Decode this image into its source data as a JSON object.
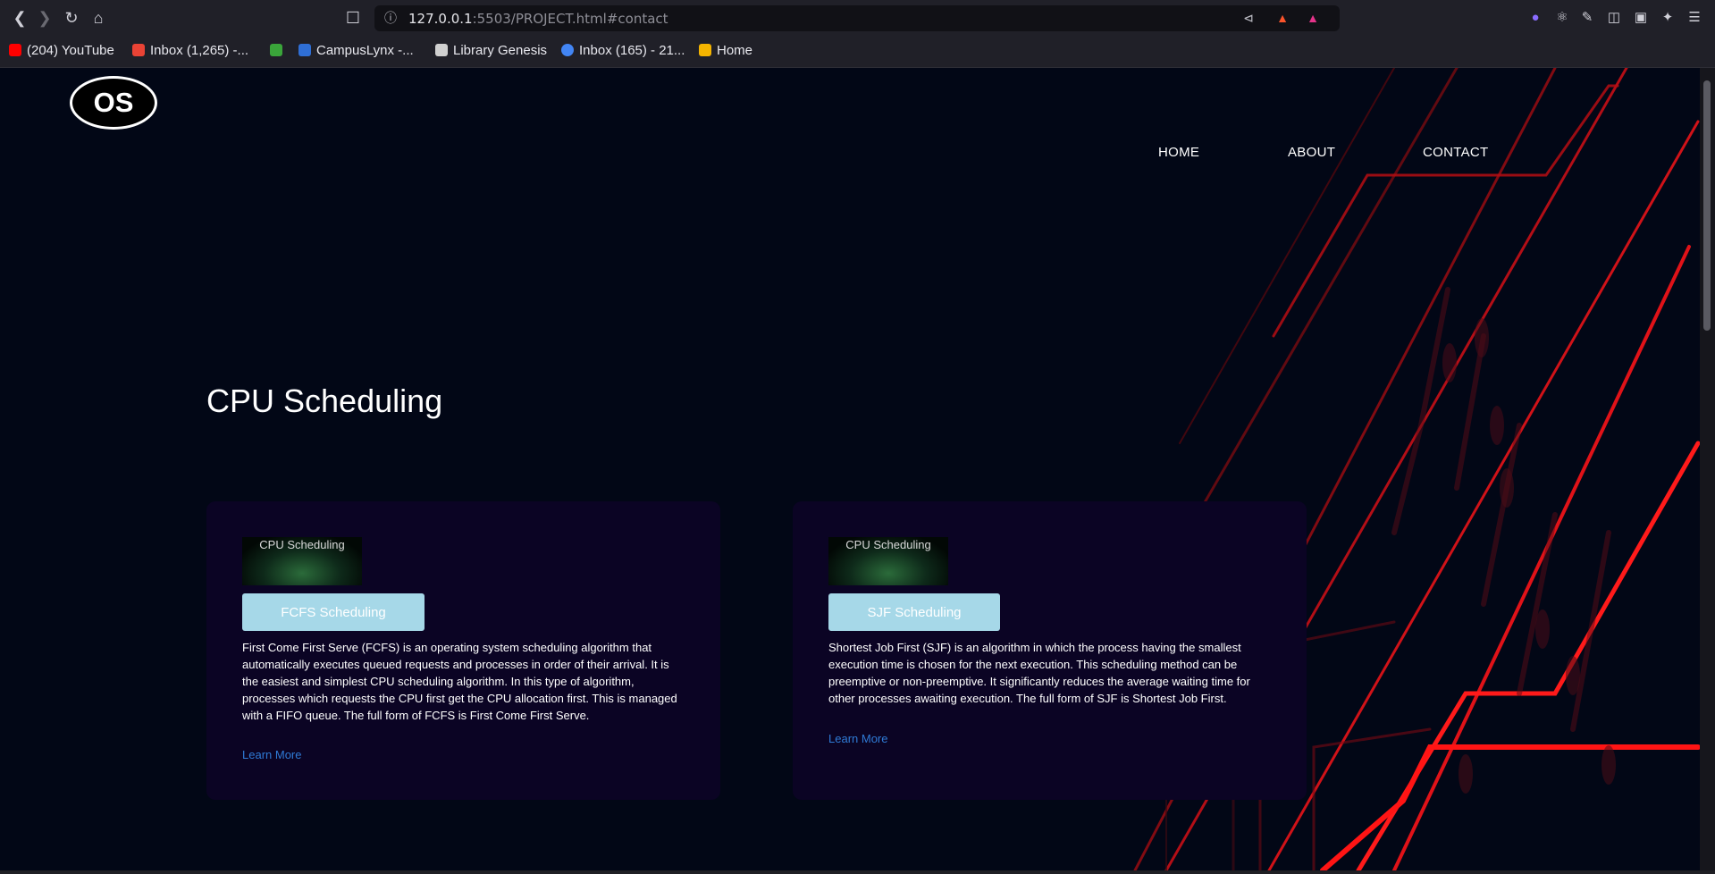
{
  "browser": {
    "url_host": "127.0.0.1",
    "url_path": ":5503/PROJECT.html#contact",
    "shields_badge": "3"
  },
  "bookmarks": [
    {
      "label": "(204) YouTube",
      "color": "#ff0000"
    },
    {
      "label": "Inbox (1,265) -...",
      "color": "#ea4335"
    },
    {
      "label": "",
      "color": "#3aa53a"
    },
    {
      "label": "CampusLynx -...",
      "color": "#2f6fd6"
    },
    {
      "label": "Library Genesis",
      "color": "#d0d0d0"
    },
    {
      "label": "Inbox (165) - 21...",
      "color": "#4285f4"
    },
    {
      "label": "Home",
      "color": "#f4b400"
    }
  ],
  "site": {
    "logo_text": "OS",
    "nav": [
      "HOME",
      "ABOUT",
      "CONTACT"
    ],
    "hero_title": "CPU Scheduling",
    "accent_color": "#a6d8e8",
    "link_color": "#2f7bd6"
  },
  "cards": [
    {
      "image_label": "CPU Scheduling",
      "button": "FCFS Scheduling",
      "description": "First Come First Serve (FCFS) is an operating system scheduling algorithm that automatically executes queued requests and processes in order of their arrival. It is the easiest and simplest CPU scheduling algorithm. In this type of algorithm, processes which requests the CPU first get the CPU allocation first. This is managed with a FIFO queue. The full form of FCFS is First Come First Serve.",
      "link": "Learn More"
    },
    {
      "image_label": "CPU Scheduling",
      "button": "SJF Scheduling",
      "description": "Shortest Job First (SJF) is an algorithm in which the process having the smallest execution time is chosen for the next execution. This scheduling method can be preemptive or non-preemptive. It significantly reduces the average waiting time for other processes awaiting execution. The full form of SJF is Shortest Job First.",
      "link": "Learn More"
    }
  ]
}
